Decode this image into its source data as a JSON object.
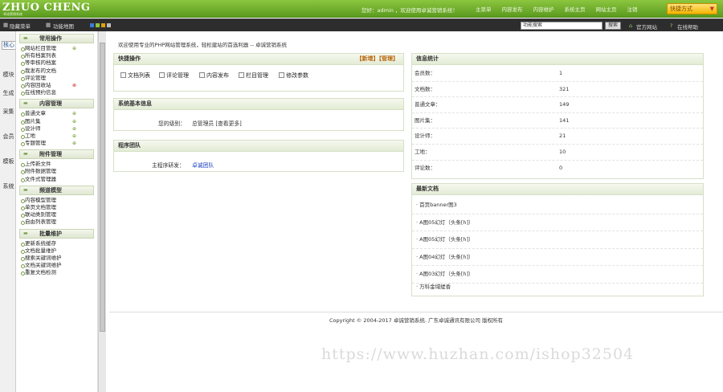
{
  "header": {
    "logo": "ZHUO CHENG",
    "logo_sub": "卓成营销系统",
    "welcome": "您好：admin ，欢迎使用卓诚营销系统！",
    "nav": [
      "主菜单",
      "内容发布",
      "内容维护",
      "系统主页",
      "网站主页",
      "注销"
    ],
    "quick_label": "快捷方式",
    "quick_arrow": "▼"
  },
  "toolbar": {
    "hide_menu": "隐藏菜单",
    "site_map": "功能地图",
    "skin_colors": [
      "#3b7bd6",
      "#8cc63f",
      "#e0a000",
      "#bbbbbb"
    ],
    "search_value": "功能搜索",
    "search_button": "搜索",
    "official_site": "官方网站",
    "online_help": "在线帮助"
  },
  "vtabs": [
    "核心",
    "模块",
    "生成",
    "采集",
    "会员",
    "模板",
    "系统"
  ],
  "sidebar": {
    "groups": [
      {
        "title": "常用操作",
        "items": [
          {
            "label": "网站栏目管理",
            "action": "+"
          },
          {
            "label": "所有档案列表",
            "action": ""
          },
          {
            "label": "等审核的档案",
            "action": ""
          },
          {
            "label": "我发布的文档",
            "action": ""
          },
          {
            "label": "评论管理",
            "action": ""
          },
          {
            "label": "内容回收站",
            "action": "x"
          },
          {
            "label": "在线预约信息",
            "action": ""
          }
        ]
      },
      {
        "title": "内容管理",
        "items": [
          {
            "label": "普通文章",
            "action": "+"
          },
          {
            "label": "图片集",
            "action": "+"
          },
          {
            "label": "设计师",
            "action": "+"
          },
          {
            "label": "工地",
            "action": "+"
          },
          {
            "label": "专题管理",
            "action": "+"
          }
        ]
      },
      {
        "title": "附件管理",
        "items": [
          {
            "label": "上传新文件",
            "action": ""
          },
          {
            "label": "附件数据管理",
            "action": ""
          },
          {
            "label": "文件式管理器",
            "action": ""
          }
        ]
      },
      {
        "title": "频道模型",
        "items": [
          {
            "label": "内容模型管理",
            "action": ""
          },
          {
            "label": "单页文档管理",
            "action": ""
          },
          {
            "label": "联动类别管理",
            "action": ""
          },
          {
            "label": "自由列表管理",
            "action": ""
          }
        ]
      },
      {
        "title": "批量维护",
        "items": [
          {
            "label": "更新系统缓存",
            "action": ""
          },
          {
            "label": "文档批量维护",
            "action": ""
          },
          {
            "label": "搜索关键词维护",
            "action": ""
          },
          {
            "label": "文档关键词维护",
            "action": ""
          },
          {
            "label": "重复文档检测",
            "action": ""
          }
        ]
      }
    ]
  },
  "main": {
    "welcome": "欢迎使用专业的PHP网站管理系统，轻松建站的首选利器 -- 卓诚营销系统",
    "quick": {
      "title": "快捷操作",
      "links": "【新增】【管理】",
      "items": [
        "文档列表",
        "评论管理",
        "内容发布",
        "栏目管理",
        "修改参数"
      ]
    },
    "basic": {
      "title": "系统基本信息",
      "label": "您的级别：",
      "value": "总管理员 [查看更多]"
    },
    "team": {
      "title": "程序团队",
      "label": "主程序研发：",
      "value": "卓诚团队"
    },
    "stats": {
      "title": "信息统计",
      "rows": [
        {
          "k": "会员数：",
          "v": "1"
        },
        {
          "k": "文档数：",
          "v": "321"
        },
        {
          "k": "普通文章：",
          "v": "149"
        },
        {
          "k": "图片集：",
          "v": "141"
        },
        {
          "k": "设计师：",
          "v": "21"
        },
        {
          "k": "工地：",
          "v": "10"
        },
        {
          "k": "评论数：",
          "v": "0"
        }
      ]
    },
    "news": {
      "title": "最新文档",
      "rows": [
        "· 首页banner图3",
        "· A图05幻灯（头条[h]）",
        "· A图05幻灯（头条[h]）",
        "· A图04幻灯（头条[h]）",
        "· A图03幻灯（头条[h]）",
        "· 万科金域缇香"
      ]
    },
    "footer": "Copyright © 2004-2017 卓诚营销系统. 广东卓诚通讯有限公司 版权所有"
  },
  "watermark": "https://www.huzhan.com/ishop32504"
}
